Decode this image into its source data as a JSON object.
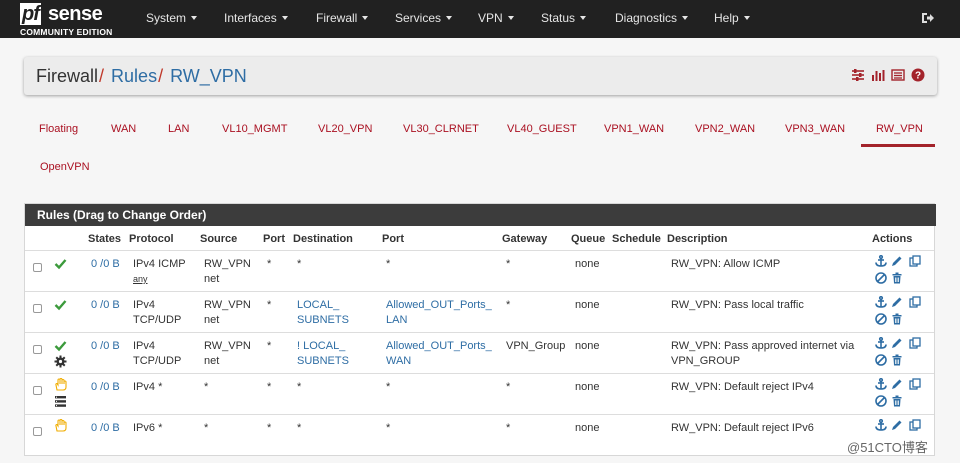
{
  "navbar": {
    "logo_pf": "pf",
    "logo_sense": "sense",
    "logo_edition": "COMMUNITY EDITION",
    "menus": [
      "System",
      "Interfaces",
      "Firewall",
      "Services",
      "VPN",
      "Status",
      "Diagnostics",
      "Help"
    ]
  },
  "breadcrumb": {
    "root": "Firewall",
    "sep1": "/",
    "rules": "Rules",
    "sep2": "/",
    "current": "RW_VPN"
  },
  "tabs": [
    "Floating",
    "WAN",
    "LAN",
    "VL10_MGMT",
    "VL20_VPN",
    "VL30_CLRNET",
    "VL40_GUEST",
    "VPN1_WAN",
    "VPN2_WAN",
    "VPN3_WAN",
    "RW_VPN",
    "OpenVPN"
  ],
  "active_tab": "RW_VPN",
  "rules_panel": {
    "title": "Rules (Drag to Change Order)",
    "columns": [
      "States",
      "Protocol",
      "Source",
      "Port",
      "Destination",
      "Port",
      "Gateway",
      "Queue",
      "Schedule",
      "Description",
      "Actions"
    ],
    "rows": [
      {
        "status": "pass",
        "extra_icon": "",
        "states": "0 /0 B",
        "protocol_1": "IPv4 ICMP",
        "protocol_2": "any",
        "source_1": "RW_VPN",
        "source_2": "net",
        "src_port": "*",
        "dest_1": "*",
        "dest_2": "",
        "dst_port_1": "*",
        "dst_port_2": "",
        "gateway": "*",
        "queue": "none",
        "schedule": "",
        "desc_1": "RW_VPN: Allow ICMP",
        "desc_2": ""
      },
      {
        "status": "pass",
        "extra_icon": "",
        "states": "0 /0 B",
        "protocol_1": "IPv4",
        "protocol_2": "TCP/UDP",
        "source_1": "RW_VPN",
        "source_2": "net",
        "src_port": "*",
        "dest_1": "LOCAL_",
        "dest_2": "SUBNETS",
        "dst_port_1": "Allowed_OUT_Ports_",
        "dst_port_2": "LAN",
        "gateway": "*",
        "queue": "none",
        "schedule": "",
        "desc_1": "RW_VPN: Pass local traffic",
        "desc_2": ""
      },
      {
        "status": "pass",
        "extra_icon": "gear-icon",
        "states": "0 /0 B",
        "protocol_1": "IPv4",
        "protocol_2": "TCP/UDP",
        "source_1": "RW_VPN",
        "source_2": "net",
        "src_port": "*",
        "dest_1": "! LOCAL_",
        "dest_2": "SUBNETS",
        "dst_port_1": "Allowed_OUT_Ports_",
        "dst_port_2": "WAN",
        "gateway": "VPN_Group",
        "queue": "none",
        "schedule": "",
        "desc_1": "RW_VPN: Pass approved internet via",
        "desc_2": "VPN_GROUP"
      },
      {
        "status": "reject",
        "extra_icon": "log-icon",
        "states": "0 /0 B",
        "protocol_1": "IPv4 *",
        "protocol_2": "",
        "source_1": "*",
        "source_2": "",
        "src_port": "*",
        "dest_1": "*",
        "dest_2": "",
        "dst_port_1": "*",
        "dst_port_2": "",
        "gateway": "*",
        "queue": "none",
        "schedule": "",
        "desc_1": "RW_VPN: Default reject IPv4",
        "desc_2": ""
      },
      {
        "status": "reject",
        "extra_icon": "",
        "states": "0 /0 B",
        "protocol_1": "IPv6 *",
        "protocol_2": "",
        "source_1": "*",
        "source_2": "",
        "src_port": "*",
        "dest_1": "*",
        "dest_2": "",
        "dst_port_1": "*",
        "dst_port_2": "",
        "gateway": "*",
        "queue": "none",
        "schedule": "",
        "desc_1": "RW_VPN: Default reject IPv6",
        "desc_2": ""
      }
    ]
  },
  "watermark": "@51CTO博客",
  "colors": {
    "navbar_bg": "#212121",
    "accent_red": "#a3232b",
    "link_blue": "#2e6da4",
    "pass_green": "#3c9a3c",
    "reject_yellow": "#f0ad00",
    "panel_header": "#3c3c3c"
  }
}
